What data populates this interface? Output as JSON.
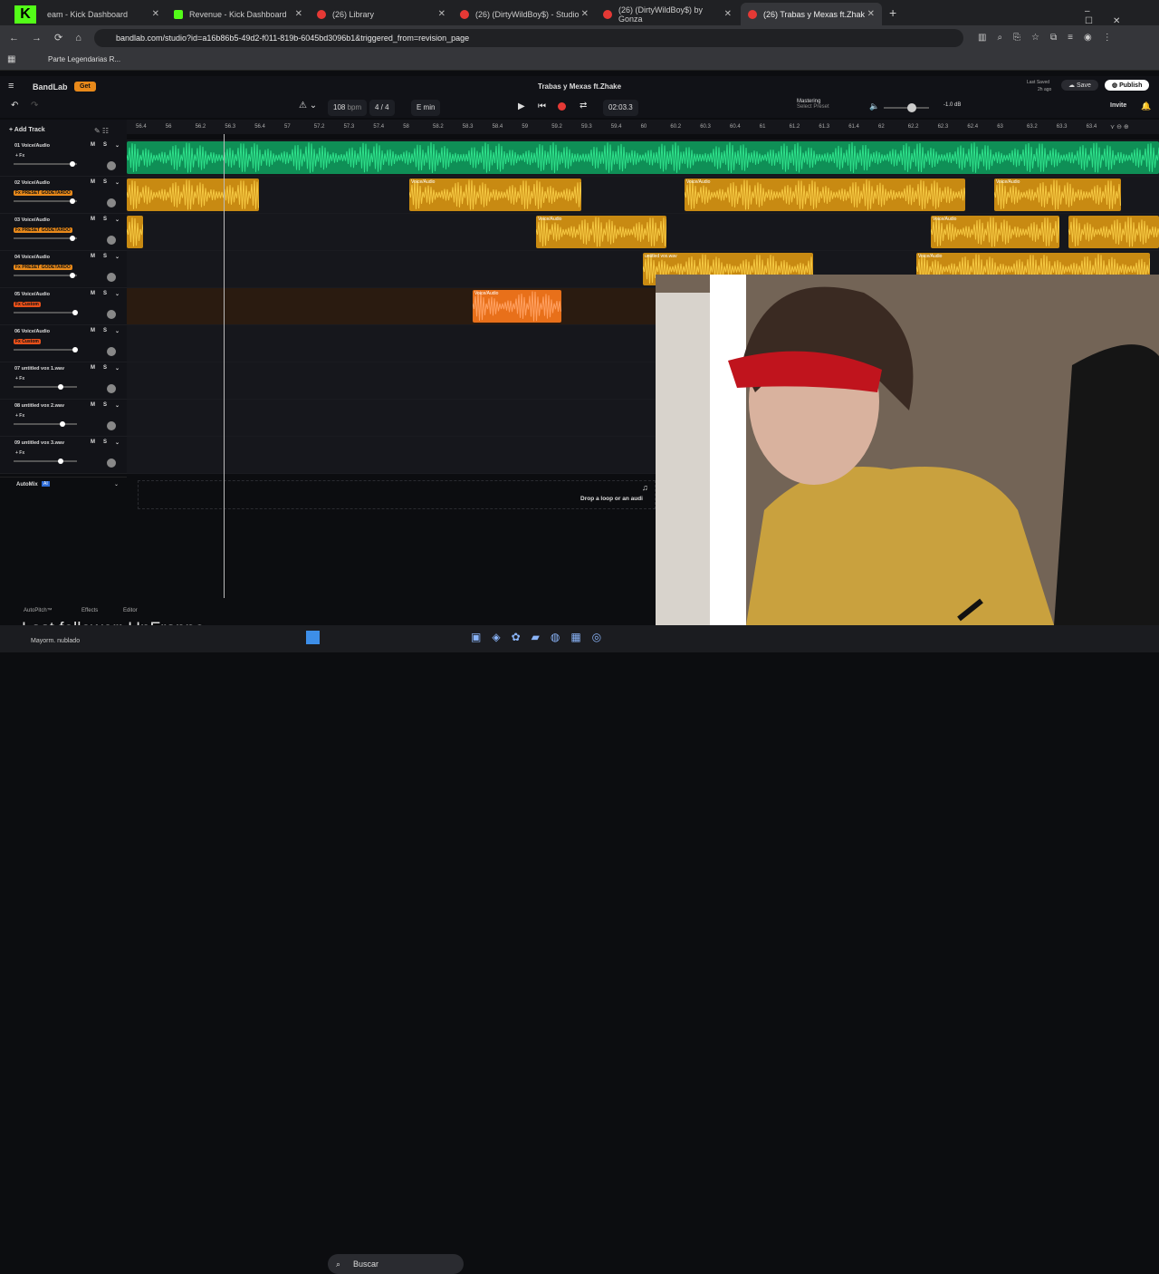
{
  "browser": {
    "tabs": [
      {
        "label": "eam - Kick Dashboard",
        "type": "k"
      },
      {
        "label": "Revenue - Kick Dashboard",
        "type": "k"
      },
      {
        "label": "(26) Library",
        "type": "b"
      },
      {
        "label": "(26) (DirtyWildBoy$) - Studio",
        "type": "b"
      },
      {
        "label": "(26) (DirtyWildBoy$) by Gonza",
        "type": "b"
      },
      {
        "label": "(26) Trabas y Mexas ft.Zhak",
        "type": "b"
      }
    ],
    "url": "bandlab.com/studio?id=a16b86b5-49d2-f011-819b-6045bd3096b1&triggered_from=revision_page",
    "bookmark": "Parte Legendarias R..."
  },
  "app": {
    "logo": "BandLab",
    "get_label": "Get",
    "title": "Trabas y Mexas ft.Zhake",
    "last_saved_1": "Last Saved",
    "last_saved_2": "2h ago",
    "save_label": "Save",
    "publish_label": "Publish",
    "invite_label": "Invite"
  },
  "toolbar": {
    "bpm": "108",
    "bpm_unit": "bpm",
    "signature": "4 / 4",
    "key": "E min",
    "time": "02:03.3",
    "mastering": "Mastering",
    "mastering_sub": "Select Preset",
    "db": "-1.0 dB",
    "add_track": "Add Track"
  },
  "ruler": [
    "56.4",
    "56",
    "56.2",
    "56.3",
    "56.4",
    "57",
    "57.2",
    "57.3",
    "57.4",
    "58",
    "58.2",
    "58.3",
    "58.4",
    "59",
    "59.2",
    "59.3",
    "59.4",
    "60",
    "60.2",
    "60.3",
    "60.4",
    "61",
    "61.2",
    "61.3",
    "61.4",
    "62",
    "62.2",
    "62.3",
    "62.4",
    "63",
    "63.2",
    "63.3",
    "63.4"
  ],
  "tracks": [
    {
      "name": "01  Voice/Audio",
      "fx": "+ Fx",
      "fxstyle": "plain",
      "vol": 0.95
    },
    {
      "name": "02  Voice/Audio",
      "fx": "Fx PRESET GODETARDO",
      "fxstyle": "orange",
      "vol": 0.95
    },
    {
      "name": "03  Voice/Audio",
      "fx": "Fx PRESET GODETARDO",
      "fxstyle": "orange",
      "vol": 0.95
    },
    {
      "name": "04  Voice/Audio",
      "fx": "Fx PRESET GODETARDO",
      "fxstyle": "orange",
      "vol": 0.95
    },
    {
      "name": "05  Voice/Audio",
      "fx": "Fx Custom",
      "fxstyle": "red",
      "vol": 1.0
    },
    {
      "name": "06  Voice/Audio",
      "fx": "Fx Custom",
      "fxstyle": "red",
      "vol": 1.0
    },
    {
      "name": "07  untitled vox 1.wav",
      "fx": "+ Fx",
      "fxstyle": "plain",
      "vol": 0.75
    },
    {
      "name": "08  untitled vox 2.wav",
      "fx": "+ Fx",
      "fxstyle": "plain",
      "vol": 0.78
    },
    {
      "name": "09  untitled vox 3.wav",
      "fx": "+ Fx",
      "fxstyle": "plain",
      "vol": 0.75
    }
  ],
  "clip_label": "Voice/Audio",
  "clip_label_wav": "untitled vox.wav",
  "automix": "AutoMix",
  "drop_text": "Drop a loop or an audi",
  "bottom": {
    "autopitch": "AutoPitch™",
    "effects": "Effects",
    "editor": "Editor"
  },
  "overlay": {
    "last_follower": "Last follower: UnFrappe",
    "weather": "Mayorm. nublado"
  },
  "taskbar": {
    "search": "Buscar"
  }
}
